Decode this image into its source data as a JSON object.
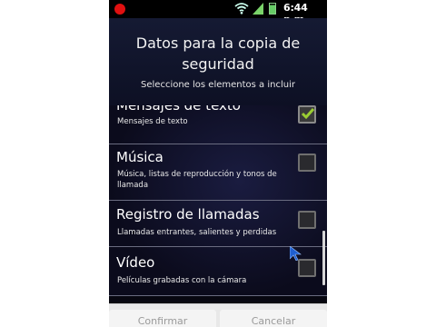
{
  "status_bar": {
    "time": "6:44 p.m.",
    "icons": [
      "record-dot-icon",
      "wifi-icon",
      "signal-icon",
      "battery-icon"
    ]
  },
  "dialog": {
    "title": "Datos para la copia de seguridad",
    "subtitle": "Seleccione los elementos a incluir"
  },
  "items": [
    {
      "title": "Mensajes de texto",
      "description": "Mensajes de texto",
      "checked": true
    },
    {
      "title": "Música",
      "description": "Música, listas de reproducción y tonos de llamada",
      "checked": false
    },
    {
      "title": "Registro de llamadas",
      "description": "Llamadas entrantes, salientes y perdidas",
      "checked": false
    },
    {
      "title": "Vídeo",
      "description": "Películas grabadas con la cámara",
      "checked": false
    }
  ],
  "buttons": {
    "confirm_label": "Confirmar",
    "cancel_label": "Cancelar"
  },
  "colors": {
    "accent_check": "#9acd32",
    "background": "#070710"
  }
}
